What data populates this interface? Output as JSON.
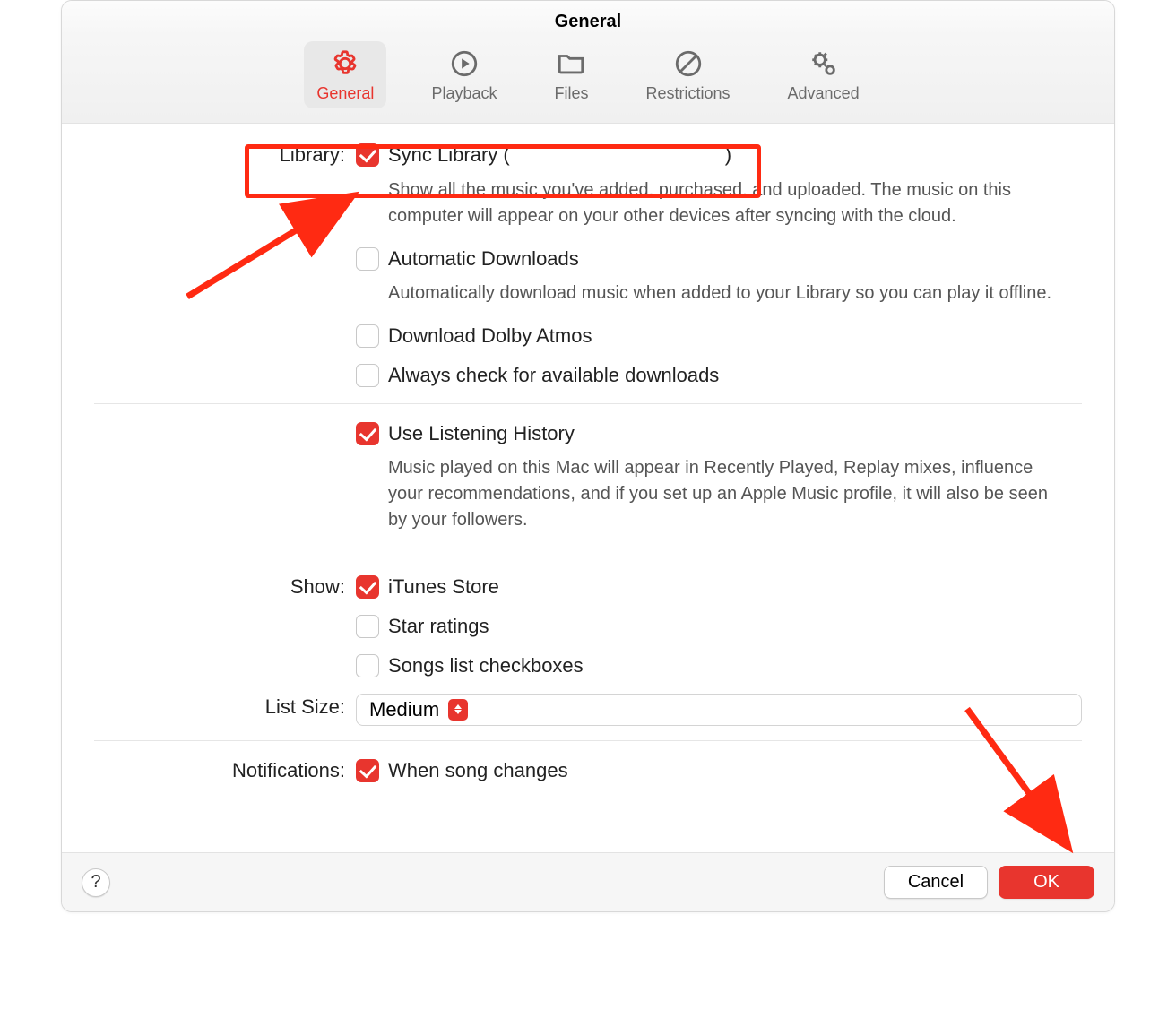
{
  "window": {
    "title": "General"
  },
  "tabs": {
    "general": {
      "label": "General"
    },
    "playback": {
      "label": "Playback"
    },
    "files": {
      "label": "Files"
    },
    "restrictions": {
      "label": "Restrictions"
    },
    "advanced": {
      "label": "Advanced"
    }
  },
  "sections": {
    "library": {
      "label": "Library:",
      "sync": {
        "label_prefix": "Sync Library (",
        "label_suffix": ")",
        "checked": true,
        "desc": "Show all the music you've added, purchased, and uploaded. The music on this computer will appear on your other devices after syncing with the cloud."
      },
      "auto_dl": {
        "label": "Automatic Downloads",
        "checked": false,
        "desc": "Automatically download music when added to your Library so you can play it offline."
      },
      "dolby": {
        "label": "Download Dolby Atmos",
        "checked": false
      },
      "always": {
        "label": "Always check for available downloads",
        "checked": false
      }
    },
    "listening": {
      "label": "Use Listening History",
      "checked": true,
      "desc": "Music played on this Mac will appear in Recently Played, Replay mixes, influence your recommendations, and if you set up an Apple Music profile, it will also be seen by your followers."
    },
    "show": {
      "label": "Show:",
      "itunes": {
        "label": "iTunes Store",
        "checked": true
      },
      "star": {
        "label": "Star ratings",
        "checked": false
      },
      "songlist": {
        "label": "Songs list checkboxes",
        "checked": false
      }
    },
    "list_size": {
      "label": "List Size:",
      "value": "Medium"
    },
    "notifications": {
      "label": "Notifications:",
      "song_changes": {
        "label": "When song changes",
        "checked": true
      }
    }
  },
  "footer": {
    "help": "?",
    "cancel": "Cancel",
    "ok": "OK"
  }
}
